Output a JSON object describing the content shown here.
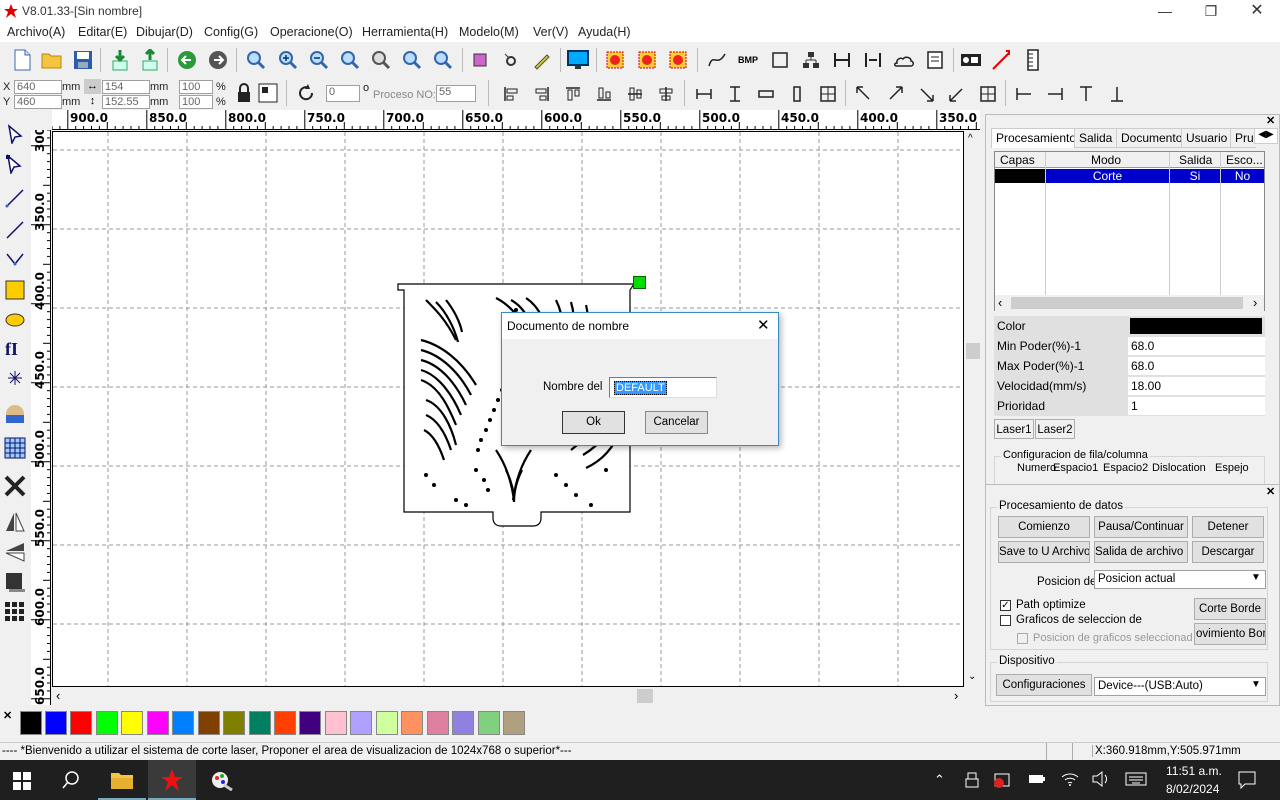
{
  "app": {
    "title": "V8.01.33-[Sin nombre]"
  },
  "menu": [
    "Archivo(A)",
    "Editar(E)",
    "Dibujar(D)",
    "Config(G)",
    "Operacione(O)",
    "Herramienta(H)",
    "Modelo(M)",
    "Ver(V)",
    "Ayuda(H)"
  ],
  "props": {
    "x_label": "X",
    "y_label": "Y",
    "x": "640",
    "y": "460",
    "unit": "mm",
    "w": "154",
    "h": "152.55",
    "sx": "100",
    "sy": "100",
    "pct": "%",
    "rot": "0",
    "deg": "o",
    "proceso_label": "Proceso NO:",
    "proceso": "55"
  },
  "ruler": {
    "h": [
      "900.0",
      "850.0",
      "800.0",
      "750.0",
      "700.0",
      "650.0",
      "600.0",
      "550.0",
      "500.0",
      "450.0",
      "400.0",
      "350.0"
    ],
    "v": [
      "300",
      "350.0",
      "400.0",
      "450.0",
      "500.0",
      "550.0",
      "600.0",
      "650.0"
    ]
  },
  "dialog": {
    "title": "Documento de nombre",
    "field_label": "Nombre del",
    "field_value": "DEFAULT",
    "ok": "Ok",
    "cancel": "Cancelar"
  },
  "right_tabs": [
    "Procesamiento",
    "Salida",
    "Documento",
    "Usuario",
    "Pru"
  ],
  "layers": {
    "headers": [
      "Capas",
      "Modo",
      "Salida",
      "Esco..."
    ],
    "rows": [
      {
        "color": "#000000",
        "mode": "Corte",
        "output": "Si",
        "esco": "No"
      }
    ]
  },
  "layer_props": [
    {
      "label": "Color",
      "value": ""
    },
    {
      "label": "Min Poder(%)-1",
      "value": "68.0"
    },
    {
      "label": "Max Poder(%)-1",
      "value": "68.0"
    },
    {
      "label": "Velocidad(mm/s)",
      "value": "18.00"
    },
    {
      "label": "Prioridad",
      "value": "1"
    }
  ],
  "laser_tabs": [
    "Laser1",
    "Laser2"
  ],
  "rowcol": {
    "title": "Configuracion de fila/columna",
    "cols": [
      "Numero",
      "Espacio1",
      "Espacio2",
      "Dislocation",
      "Espejo"
    ]
  },
  "data_proc": {
    "title": "Procesamiento de datos",
    "buttons": [
      "Comienzo",
      "Pausa/Continuar",
      "Detener",
      "Save to U Archivo",
      "Salida de archivo U",
      "Descargar"
    ],
    "position_label": "Posicion de",
    "position_value": "Posicion actual",
    "path_optimize": "Path optimize",
    "graficos": "Graficos de seleccion de",
    "posicion_graficos": "Posicion de graficos seleccionadc",
    "corte_borde": "Corte Borde",
    "movimiento": "ovimiento Bord"
  },
  "device": {
    "title": "Dispositivo",
    "config_btn": "Configuraciones",
    "value": "Device---(USB:Auto)"
  },
  "palette": [
    "#000000",
    "#0000ff",
    "#ff0000",
    "#00ff00",
    "#ffff00",
    "#ff00ff",
    "#0080ff",
    "#804000",
    "#808000",
    "#008060",
    "#ff4000",
    "#400080",
    "#ffc0d0",
    "#b0a0ff",
    "#d0ffa0",
    "#ff9060",
    "#e080a0",
    "#9080e0",
    "#80d080",
    "#b0a080"
  ],
  "status": {
    "message": "---- *Bienvenido a utilizar el sistema de corte laser, Proponer el area de visualizacion de 1024x768 o superior*---",
    "coords": "X:360.918mm,Y:505.971mm"
  },
  "taskbar": {
    "time": "11:51 a.m.",
    "date": "8/02/2024"
  },
  "colors": {
    "selected_row": "#0000cc",
    "accent": "#3a8ac4",
    "handle": "#00dd00"
  }
}
